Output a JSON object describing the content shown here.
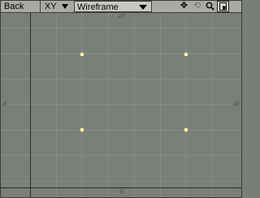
{
  "toolbar": {
    "view_name": "Back",
    "axis": "XY",
    "mode": "Wireframe",
    "tools": [
      {
        "name": "move-icon",
        "glyph": "✥"
      },
      {
        "name": "rotate-icon",
        "glyph": "⟲"
      },
      {
        "name": "zoom-icon",
        "glyph": "🔍︎"
      },
      {
        "name": "maximize-icon",
        "glyph": "▣"
      }
    ]
  },
  "axes": {
    "top": "+Y",
    "bottom": "-Y",
    "left": "-X",
    "right": "+X"
  },
  "colors": {
    "background": "#7b7f79",
    "grid_minor": "#8a8e88",
    "grid_major": "#2f2f2f",
    "vertex": "#f7f2b0"
  }
}
